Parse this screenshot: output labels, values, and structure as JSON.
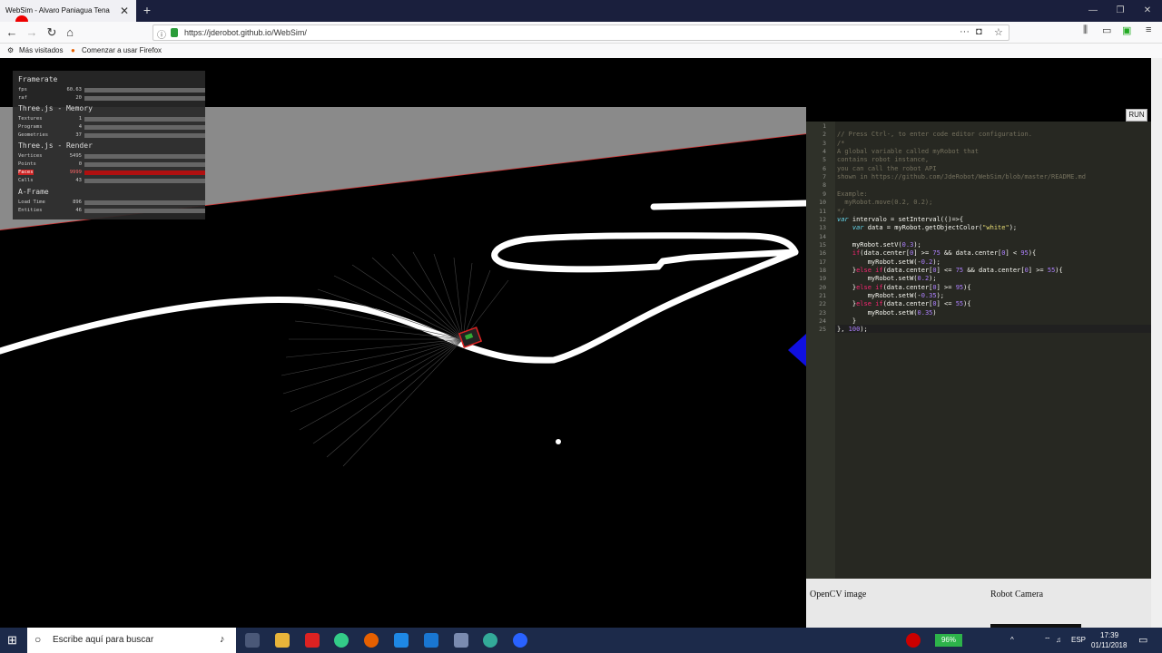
{
  "browser": {
    "tab_title": "WebSim - Alvaro Paniagua Tena",
    "tab_close": "✕",
    "new_tab": "+",
    "url": "https://jderobot.github.io/WebSim/",
    "bookmarks": [
      "Más visitados",
      "Comenzar a usar Firefox"
    ]
  },
  "stats": {
    "sections": [
      {
        "title": "Framerate",
        "rows": [
          {
            "label": "fps",
            "value": "60.63"
          },
          {
            "label": "raf",
            "value": "20"
          }
        ]
      },
      {
        "title": "Three.js - Memory",
        "rows": [
          {
            "label": "Textures",
            "value": "1"
          },
          {
            "label": "Programs",
            "value": "4"
          },
          {
            "label": "Geometries",
            "value": "37"
          }
        ]
      },
      {
        "title": "Three.js - Render",
        "rows": [
          {
            "label": "Vertices",
            "value": "5495"
          },
          {
            "label": "Points",
            "value": "0"
          },
          {
            "label": "Faces",
            "value": "9999"
          },
          {
            "label": "Calls",
            "value": "43"
          }
        ]
      },
      {
        "title": "A-Frame",
        "rows": [
          {
            "label": "Load Time",
            "value": "896"
          },
          {
            "label": "Entities",
            "value": "46"
          }
        ]
      }
    ]
  },
  "editor": {
    "run_label": "RUN",
    "line_numbers": [
      "1",
      "2",
      "3",
      "4",
      "5",
      "6",
      "7",
      "8",
      "9",
      "10",
      "11",
      "12",
      "13",
      "14",
      "15",
      "16",
      "17",
      "18",
      "19",
      "20",
      "21",
      "22",
      "23",
      "24",
      "25"
    ],
    "lines": [
      "",
      "// Press Ctrl-, to enter code editor configuration.",
      "/*",
      "A global variable called myRobot that",
      "contains robot instance,",
      "you can call the robot API",
      "shown in https://github.com/JdeRobot/WebSim/blob/master/README.md",
      "",
      "Example:",
      "  myRobot.move(0.2, 0.2);",
      "*/",
      "var intervalo = setInterval(()=>{",
      "    var data = myRobot.getObjectColor(\"white\");",
      "",
      "    myRobot.setV(0.3);",
      "    if(data.center[0] >= 75 && data.center[0] < 95){",
      "        myRobot.setW(-0.2);",
      "    }else if(data.center[0] <= 75 && data.center[0] >= 55){",
      "        myRobot.setW(0.2);",
      "    }else if(data.center[0] >= 95){",
      "        myRobot.setW(-0.35);",
      "    }else if(data.center[0] <= 55){",
      "        myRobot.setW(0.35)",
      "    }",
      "}, 100);"
    ]
  },
  "panels": {
    "opencv_title": "OpenCV image",
    "camera_title": "Robot Camera"
  },
  "taskbar": {
    "search_placeholder": "Escribe aquí para buscar",
    "battery": "96%",
    "lang": "ESP",
    "time": "17:39",
    "date": "01/11/2018"
  }
}
